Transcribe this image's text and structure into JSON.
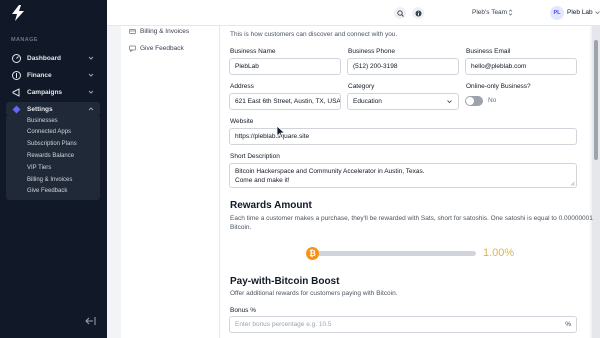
{
  "sidebar": {
    "section_label": "MANAGE",
    "items": [
      {
        "label": "Dashboard",
        "icon": "dashboard-icon"
      },
      {
        "label": "Finance",
        "icon": "finance-icon"
      },
      {
        "label": "Campaigns",
        "icon": "campaigns-icon"
      },
      {
        "label": "Settings",
        "icon": "settings-icon"
      }
    ],
    "subitems": [
      "Businesses",
      "Connected Apps",
      "Subscription Plans",
      "Rewards Balance",
      "VIP Tiers",
      "Billing & Invoices",
      "Give Feedback"
    ]
  },
  "topbar": {
    "team": "Pleb's Team",
    "avatar_initials": "PL",
    "user": "Pleb Lab"
  },
  "settings_menu": {
    "items": [
      "Billing & Invoices",
      "Give Feedback"
    ]
  },
  "form": {
    "intro": "This is how customers can discover and connect with you.",
    "business_name": {
      "label": "Business Name",
      "value": "PlebLab"
    },
    "business_phone": {
      "label": "Business Phone",
      "value": "(512) 200-3198"
    },
    "business_email": {
      "label": "Business Email",
      "value": "hello@pleblab.com"
    },
    "address": {
      "label": "Address",
      "value": "621 East 6th Street, Austin, TX, USA"
    },
    "category": {
      "label": "Category",
      "value": "Education"
    },
    "online_only": {
      "label": "Online-only Business?",
      "value": "No"
    },
    "website": {
      "label": "Website",
      "value": "https://pleblab.square.site"
    },
    "short_description": {
      "label": "Short Description",
      "line1": "Bitcoin Hackerspace and Community Accelerator in Austin, Texas.",
      "line2": "Come and make it!"
    }
  },
  "rewards": {
    "title": "Rewards Amount",
    "desc_line1": "Each time a customer makes a purchase, they'll be rewarded with Sats, short for satoshis. One satoshi is equal to 0.00000001",
    "desc_line2": "Bitcoin.",
    "percent_label": "1.00%",
    "slider_fraction": 0.0
  },
  "boost": {
    "title": "Pay-with-Bitcoin Boost",
    "desc": "Offer additional rewards for customers paying with Bitcoin.",
    "bonus_label": "Bonus %",
    "bonus_placeholder": "Enter bonus percentage e.g. 10.5",
    "suffix": "%"
  },
  "colors": {
    "sidebar_bg": "#111827",
    "bitcoin_orange": "#f7931a",
    "percent_gold": "#e0b34a"
  }
}
